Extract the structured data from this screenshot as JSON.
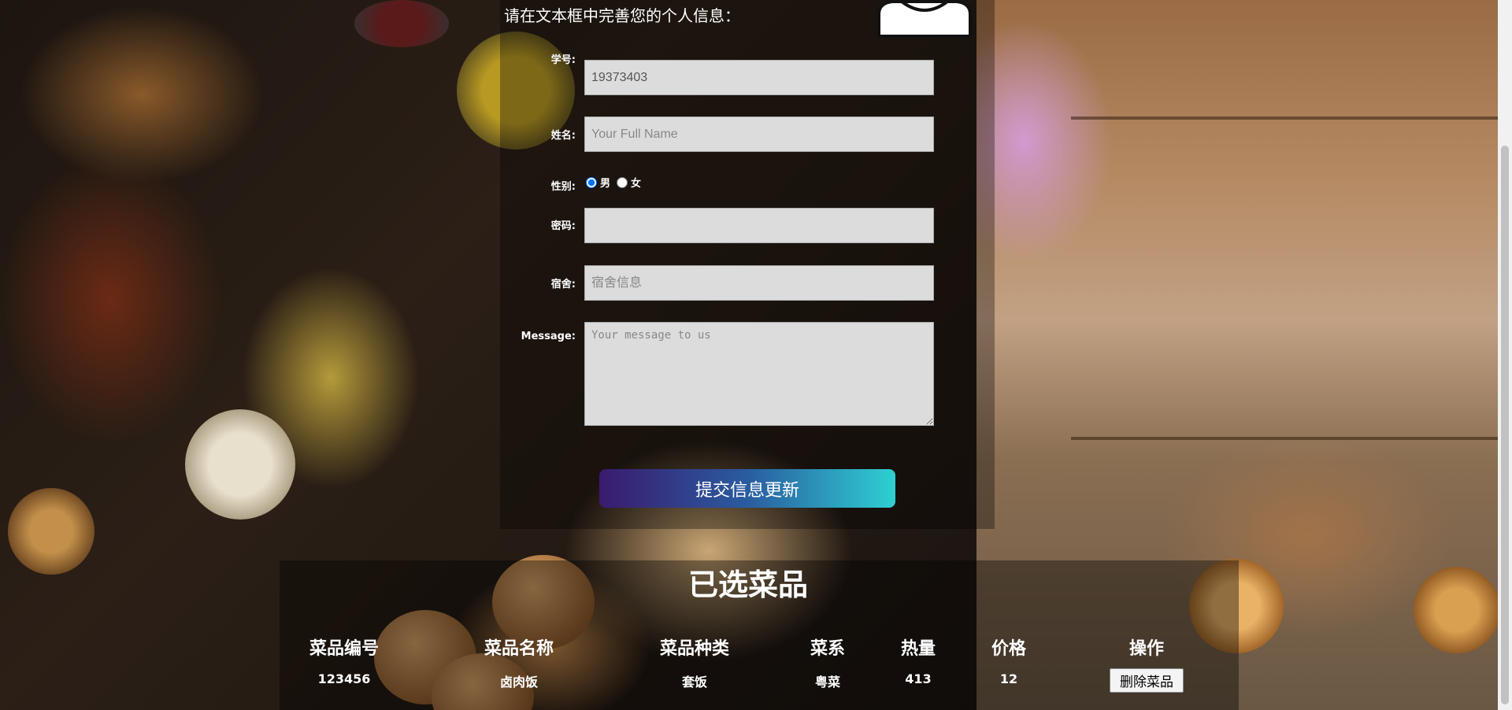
{
  "form": {
    "intro": "请在文本框中完善您的个人信息：",
    "student_id": {
      "label": "学号:",
      "value": "19373403"
    },
    "name": {
      "label": "姓名:",
      "placeholder": "Your Full Name"
    },
    "gender": {
      "label": "性别:",
      "options": [
        "男",
        "女"
      ],
      "selected": "男"
    },
    "password": {
      "label": "密码:"
    },
    "dorm": {
      "label": "宿舍:",
      "placeholder": "宿舍信息"
    },
    "message": {
      "label": "Message:",
      "placeholder": "Your message to us"
    },
    "submit_label": "提交信息更新"
  },
  "table": {
    "title": "已选菜品",
    "headers": [
      "菜品编号",
      "菜品名称",
      "菜品种类",
      "菜系",
      "热量",
      "价格",
      "操作"
    ],
    "rows": [
      {
        "id": "123456",
        "name": "卤肉饭",
        "category": "套饭",
        "cuisine": "粤菜",
        "calories": "413",
        "price": "12",
        "action": "删除菜品"
      }
    ]
  },
  "colors": {
    "submit_gradient": [
      "#3a1a6e",
      "#2ed0d2"
    ],
    "input_bg": "#dcdcdc"
  }
}
